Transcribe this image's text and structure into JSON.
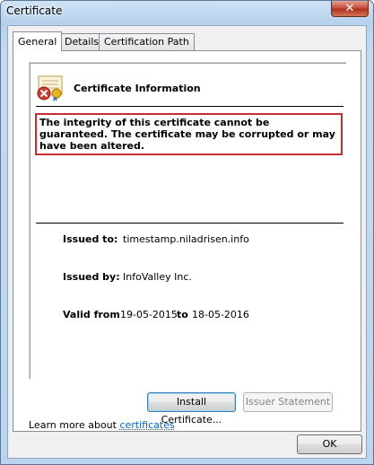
{
  "window": {
    "title": "Certificate",
    "close_symbol": "✕"
  },
  "tabs": [
    {
      "label": "General",
      "active": true
    },
    {
      "label": "Details",
      "active": false
    },
    {
      "label": "Certification Path",
      "active": false
    }
  ],
  "info": {
    "heading": "Certificate Information",
    "warning": "The integrity of this certificate cannot be guaranteed. The certificate may be corrupted or may have been altered.",
    "issued_to_label": "Issued to:",
    "issued_to_value": "timestamp.niladrisen.info",
    "issued_by_label": "Issued by:",
    "issued_by_value": "InfoValley Inc.",
    "valid_from_label": "Valid from",
    "valid_from_value": "19-05-2015",
    "valid_to_label": "to",
    "valid_to_value": "18-05-2016"
  },
  "buttons": {
    "install": "Install Certificate...",
    "issuer_statement": "Issuer Statement",
    "ok": "OK"
  },
  "learn_more": {
    "prefix": "Learn more about ",
    "link": "certificates"
  },
  "colors": {
    "warning_border": "#c42f31",
    "link": "#0066cc",
    "close_button": "#c6523f"
  },
  "icons": {
    "certificate": "certificate-error-icon",
    "close": "close-icon"
  }
}
